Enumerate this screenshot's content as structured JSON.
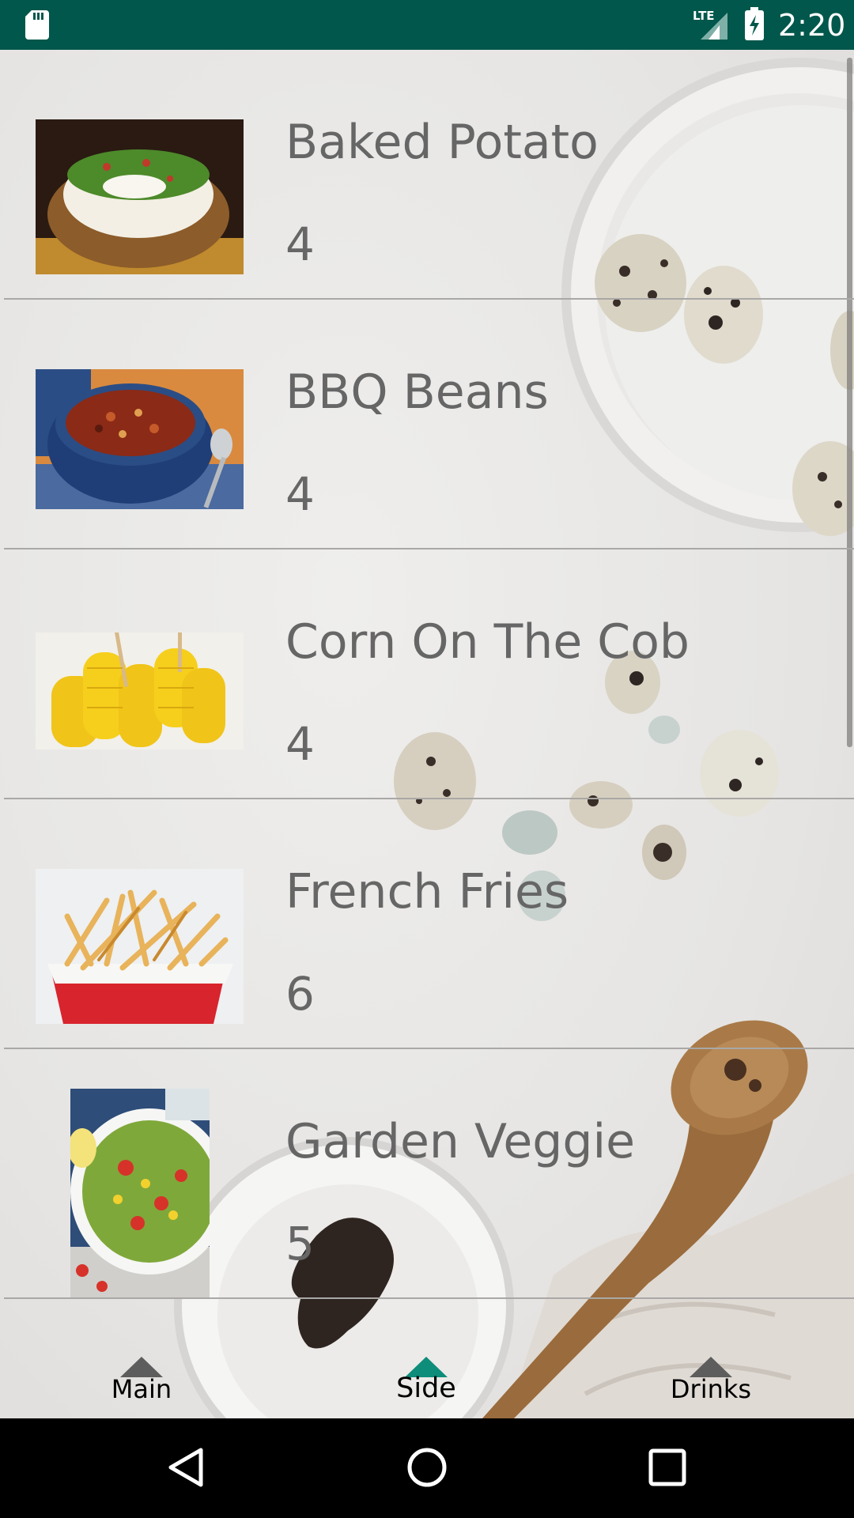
{
  "status_bar": {
    "time": "2:20",
    "network_label": "LTE",
    "icons": [
      "sd-card-icon",
      "signal-icon",
      "battery-charging-icon"
    ],
    "color": "#01574b"
  },
  "items": [
    {
      "name": "Baked Potato",
      "count": "4",
      "image": "baked-potato-image"
    },
    {
      "name": "BBQ Beans",
      "count": "4",
      "image": "bbq-beans-image"
    },
    {
      "name": "Corn On The Cob",
      "count": "4",
      "image": "corn-on-the-cob-image"
    },
    {
      "name": "French Fries",
      "count": "6",
      "image": "french-fries-image"
    },
    {
      "name": "Garden Veggie",
      "count": "5",
      "image": "garden-veggie-image"
    }
  ],
  "tabs": [
    {
      "label": "Main",
      "selected": false,
      "arrow_color": "#5d5d5d"
    },
    {
      "label": "Side",
      "selected": true,
      "arrow_color": "#0e8d7a"
    },
    {
      "label": "Drinks",
      "selected": false,
      "arrow_color": "#5d5d5d"
    }
  ],
  "nav": {
    "icons": [
      "back-icon",
      "home-icon",
      "recents-icon"
    ]
  }
}
